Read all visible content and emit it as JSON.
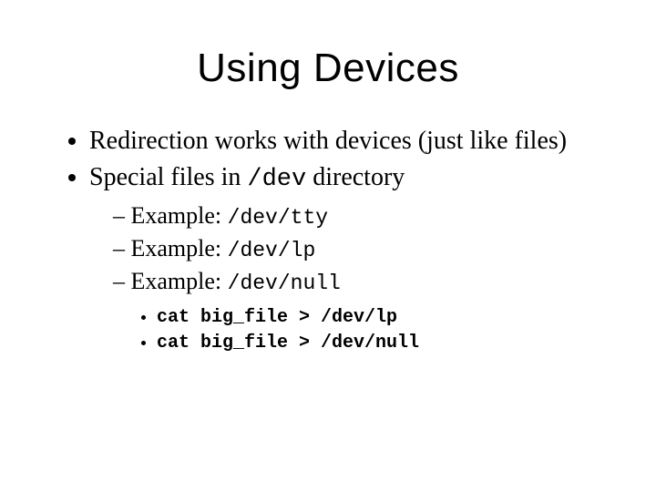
{
  "title": "Using Devices",
  "bullets": {
    "b1": "Redirection works with devices (just like files)",
    "b2_pre": "Special files in ",
    "b2_code": "/dev",
    "b2_post": " directory",
    "ex_label": "Example: ",
    "ex1_code": "/dev/tty",
    "ex2_code": "/dev/lp",
    "ex3_code": "/dev/null",
    "cmd1": "cat big_file > /dev/lp",
    "cmd2": "cat big_file > /dev/null"
  }
}
